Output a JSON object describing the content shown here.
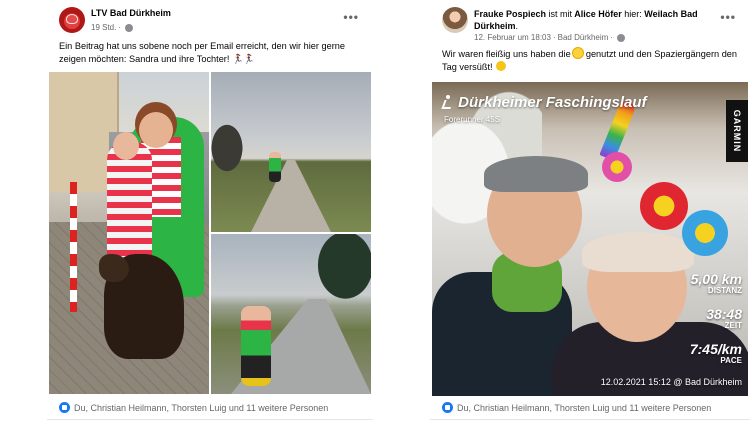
{
  "post1": {
    "author": "LTV Bad Dürkheim",
    "time": "19 Std.",
    "text": "Ein Beitrag hat uns sobene noch per Email erreicht, den wir hier gerne zeigen möchten: Sandra und ihre Tochter!",
    "text_emojis": "🏃‍♀️🏃‍♀️",
    "reactions": "Du, Christian Heilmann, Thorsten Luig und 11 weitere Personen"
  },
  "post2": {
    "author": "Frauke Pospiech",
    "with_word": "ist mit",
    "with_person": "Alice Höfer",
    "here_word": "hier:",
    "place": "Weilach Bad Dürkheim",
    "time": "12. Februar um 18:03",
    "location": "Bad Dürkheim",
    "text_a": "Wir waren fleißig uns haben die",
    "text_b": "genutzt und den Spaziergängern den Tag versüßt!",
    "reactions": "Du, Christian Heilmann, Thorsten Luig und 11 weitere Personen",
    "overlay": {
      "title": "Dürkheimer Faschingslauf",
      "subtitle": "Forerunner 45S",
      "brand": "GARMIN",
      "distance_value": "5,00 km",
      "distance_label": "DISTANZ",
      "time_value": "38:48",
      "time_label": "ZEIT",
      "pace_value": "7:45/km",
      "pace_label": "PACE",
      "footer": "12.02.2021 15:12 @ Bad Dürkheim"
    }
  },
  "icons": [
    "more-icon",
    "globe-icon",
    "like-icon",
    "run-icon",
    "sun-icon",
    "smile-icon"
  ],
  "colors": {
    "like": "#1877f2",
    "meta": "#65676b"
  }
}
